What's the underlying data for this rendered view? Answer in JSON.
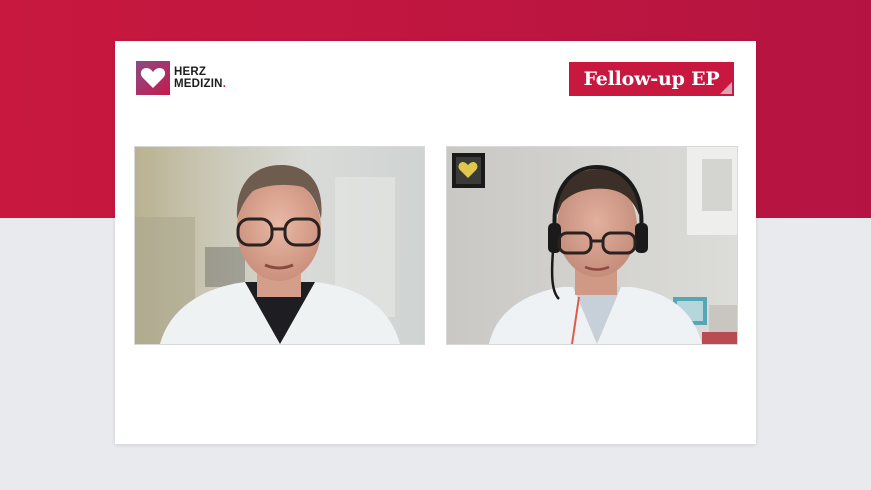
{
  "logo": {
    "line1": "HERZ",
    "line2": "MEDIZIN",
    "dot": "."
  },
  "badge": {
    "label": "Fellow-up EP"
  },
  "colors": {
    "brand_red": "#c8183f",
    "background_light": "#e9eaed",
    "card": "#ffffff"
  },
  "videos": {
    "left": {
      "icon": "video-participant-left"
    },
    "right": {
      "icon": "video-participant-right"
    }
  }
}
